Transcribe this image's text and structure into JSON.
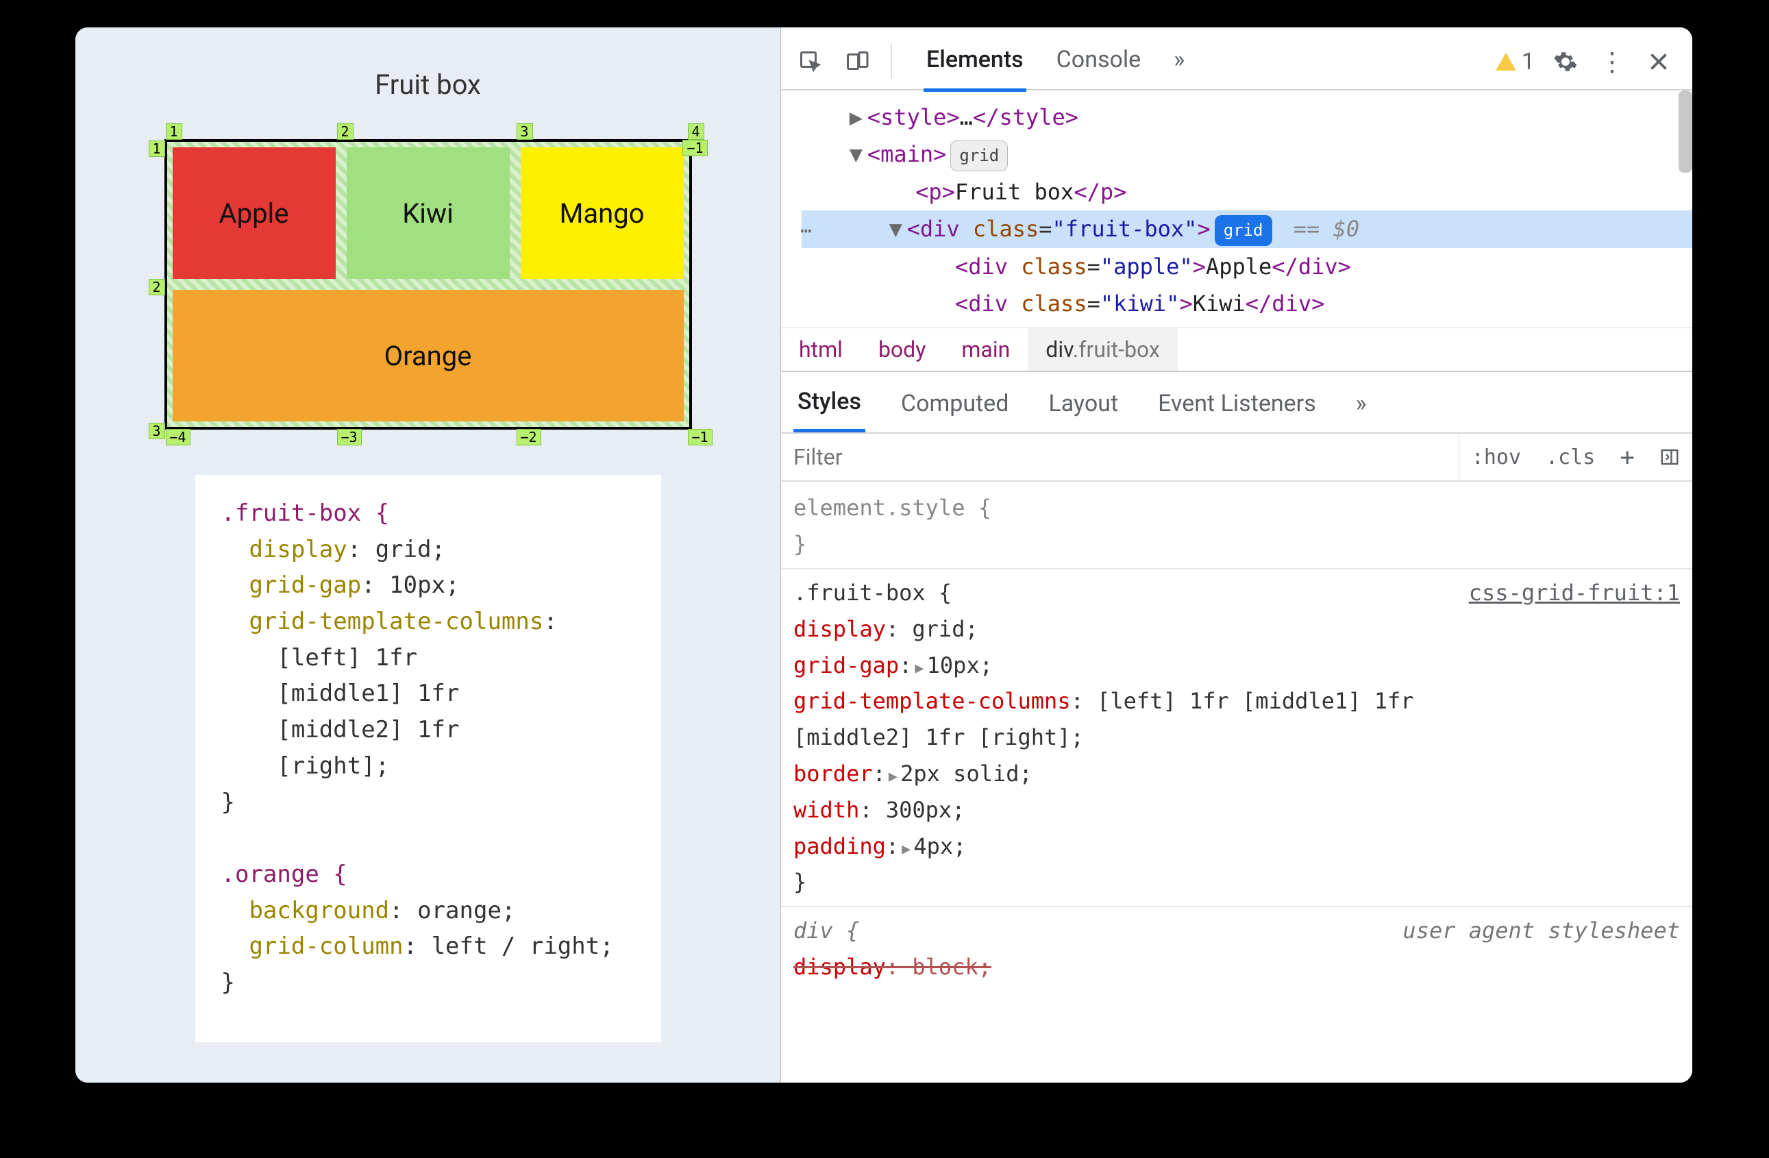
{
  "page": {
    "title": "Fruit box",
    "cells": [
      "Apple",
      "Kiwi",
      "Mango",
      "Orange"
    ],
    "grid_labels": {
      "top": [
        "1",
        "2",
        "3",
        "4"
      ],
      "neg_right_top": "−1",
      "left": [
        "1",
        "2",
        "3"
      ],
      "bottom": [
        "−4",
        "−3",
        "−2",
        "−1"
      ]
    },
    "css1_selector": ".fruit-box {",
    "css1_p1": "display",
    "css1_v1": "grid",
    "css1_p2": "grid-gap",
    "css1_v2": "10px",
    "css1_p3": "grid-template-columns",
    "css1_v3a": "[left] 1fr",
    "css1_v3b": "[middle1] 1fr",
    "css1_v3c": "[middle2] 1fr",
    "css1_v3d": "[right]",
    "css2_selector": ".orange {",
    "css2_p1": "background",
    "css2_v1": "orange",
    "css2_p2": "grid-column",
    "css2_v2": "left / right"
  },
  "devtools": {
    "tabs": {
      "elements": "Elements",
      "console": "Console"
    },
    "more": "»",
    "warn_count": "1",
    "dom": {
      "l1_open": "<style>",
      "l1_mid": "…",
      "l1_close": "</style>",
      "l2_open": "<main>",
      "l2_badge": "grid",
      "l3": "<p>Fruit box</p>",
      "l4_open_a": "<div ",
      "l4_attr": "class",
      "l4_val": "\"fruit-box\"",
      "l4_open_b": ">",
      "l4_badge": "grid",
      "l4_sel": " == $0",
      "l5_a": "<div ",
      "l5_attr": "class",
      "l5_val": "\"apple\"",
      "l5_txt": "Apple",
      "l5_close": "</div>",
      "l6_a": "<div ",
      "l6_attr": "class",
      "l6_val": "\"kiwi\"",
      "l6_txt": "Kiwi",
      "l6_close": "</div>"
    },
    "breadcrumb": {
      "a": "html",
      "b": "body",
      "c": "main",
      "d_tag": "div",
      "d_cls": ".fruit-box"
    },
    "styles_tabs": {
      "styles": "Styles",
      "computed": "Computed",
      "layout": "Layout",
      "ev": "Event Listeners",
      "more": "»"
    },
    "filter": {
      "placeholder": "Filter",
      "hov": ":hov",
      "cls": ".cls"
    },
    "rules": {
      "es_head": "element.style {",
      "close": "}",
      "r1_sel": ".fruit-box {",
      "r1_src": "css-grid-fruit:1",
      "r1_p1": "display",
      "r1_v1": "grid",
      "r1_p2": "grid-gap",
      "r1_v2": "10px",
      "r1_p3": "grid-template-columns",
      "r1_v3": "[left] 1fr [middle1] 1fr",
      "r1_v3b": "[middle2] 1fr [right]",
      "r1_p4": "border",
      "r1_v4": "2px solid",
      "r1_p5": "width",
      "r1_v5": "300px",
      "r1_p6": "padding",
      "r1_v6": "4px",
      "ua_sel": "div {",
      "ua_src": "user agent stylesheet",
      "ua_p1": "display",
      "ua_v1": "block"
    }
  }
}
